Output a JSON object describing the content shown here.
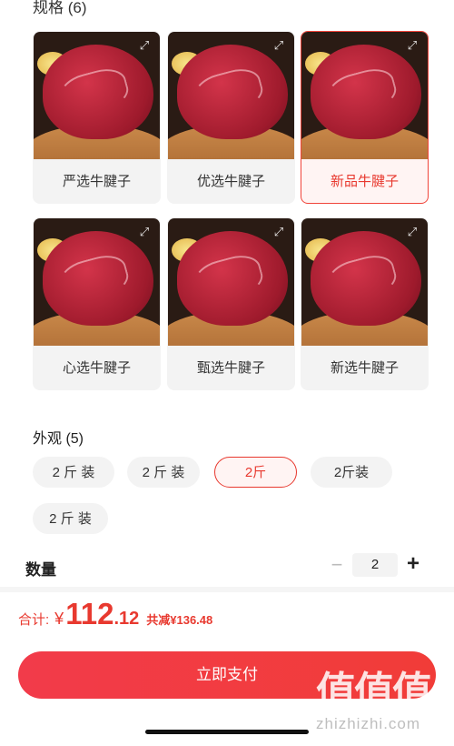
{
  "sku_section": {
    "title": "规格 (6)",
    "items": [
      {
        "label": "严选牛腱子",
        "selected": false
      },
      {
        "label": "优选牛腱子",
        "selected": false
      },
      {
        "label": "新品牛腱子",
        "selected": true
      },
      {
        "label": "心选牛腱子",
        "selected": false
      },
      {
        "label": "甄选牛腱子",
        "selected": false
      },
      {
        "label": "新选牛腱子",
        "selected": false
      }
    ]
  },
  "appearance_section": {
    "title": "外观 (5)",
    "options": [
      {
        "label": "2 斤 装",
        "selected": false
      },
      {
        "label": "2 斤 装",
        "selected": false
      },
      {
        "label": "2斤",
        "selected": true
      },
      {
        "label": "2斤装",
        "selected": false
      },
      {
        "label": "2 斤 装",
        "selected": false
      }
    ]
  },
  "quantity": {
    "label": "数量",
    "minus": "−",
    "value": "2",
    "plus": "+"
  },
  "footer": {
    "total_label": "合计:",
    "currency": "¥",
    "amount_int": "112",
    "amount_dec": ".12",
    "discount": "共减¥136.48",
    "pay_button": "立即支付"
  },
  "watermark": {
    "glyphs": "值值值",
    "site": "zhizhizhi.com"
  },
  "colors": {
    "accent": "#e8392f",
    "button": "#f23b4a"
  }
}
